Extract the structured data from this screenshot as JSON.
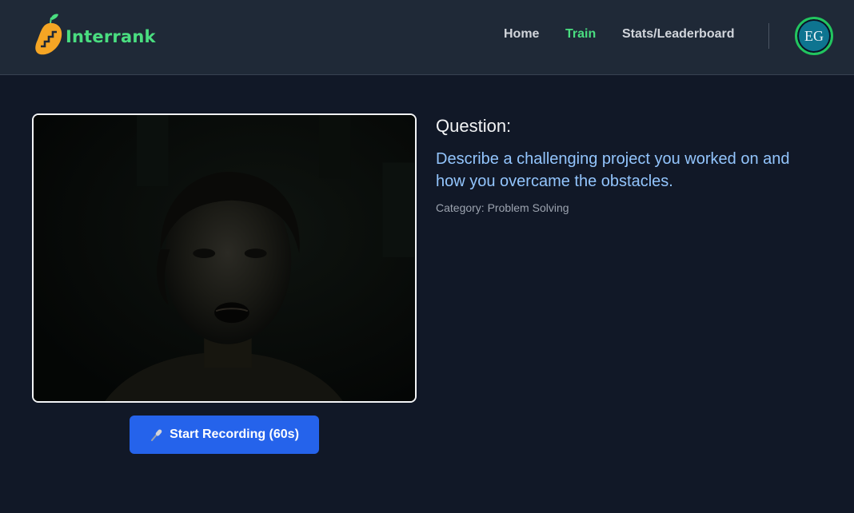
{
  "app": {
    "name": "Interrank",
    "brand_color": "#4ade80",
    "logo_icon": "mango-stairs-icon"
  },
  "nav": {
    "items": [
      {
        "label": "Home",
        "active": false,
        "color": "#d1d5db"
      },
      {
        "label": "Train",
        "active": true,
        "color": "#4ade80"
      },
      {
        "label": "Stats/Leaderboard",
        "active": false,
        "color": "#d1d5db"
      }
    ],
    "avatar_initials": "EG"
  },
  "question": {
    "heading": "Question:",
    "text": "Describe a challenging project you worked on and how you overcame the obstacles.",
    "category": "Category: Problem Solving"
  },
  "recording": {
    "button_label": "Start Recording (60s)",
    "button_icon": "microphone-icon",
    "button_color": "#2563eb"
  },
  "video": {
    "content": "webcam-feed"
  }
}
